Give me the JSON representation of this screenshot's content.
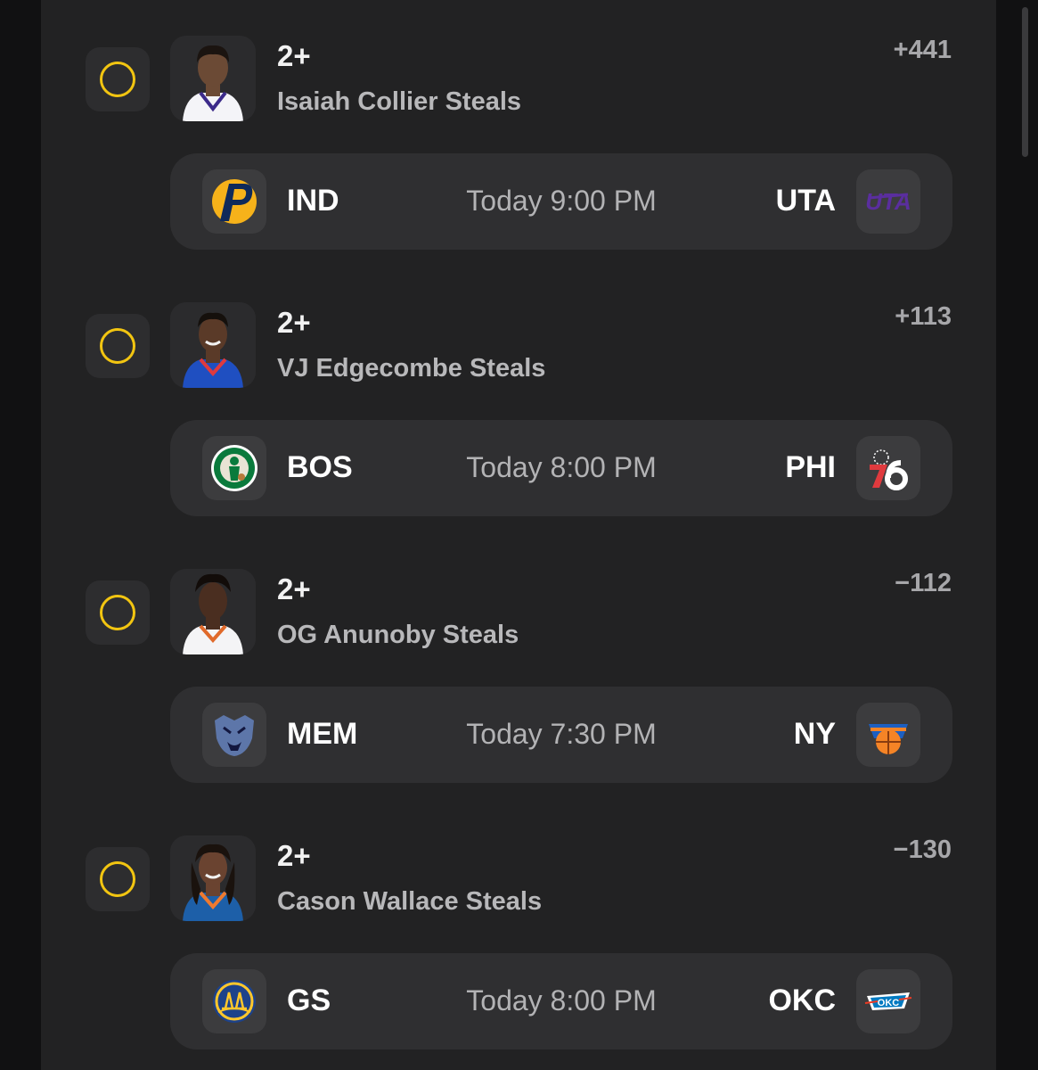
{
  "props": [
    {
      "line": "2+",
      "player": "Isaiah Collier Steals",
      "odds": "+441",
      "away_team": "IND",
      "home_team": "UTA",
      "game_time": "Today 9:00 PM",
      "away_logo": "pacers-logo",
      "home_logo": "jazz-logo",
      "jersey_color": "#f4f4f8",
      "jersey_trim": "#3b2a8a"
    },
    {
      "line": "2+",
      "player": "VJ Edgecombe Steals",
      "odds": "+113",
      "away_team": "BOS",
      "home_team": "PHI",
      "game_time": "Today 8:00 PM",
      "away_logo": "celtics-logo",
      "home_logo": "76ers-logo",
      "jersey_color": "#1f4fc1",
      "jersey_trim": "#e03a3e"
    },
    {
      "line": "2+",
      "player": "OG Anunoby Steals",
      "odds": "−112",
      "away_team": "MEM",
      "home_team": "NY",
      "game_time": "Today 7:30 PM",
      "away_logo": "grizzlies-logo",
      "home_logo": "knicks-logo",
      "jersey_color": "#f4f4f6",
      "jersey_trim": "#e06a2b"
    },
    {
      "line": "2+",
      "player": "Cason Wallace Steals",
      "odds": "−130",
      "away_team": "GS",
      "home_team": "OKC",
      "game_time": "Today 8:00 PM",
      "away_logo": "warriors-logo",
      "home_logo": "thunder-logo",
      "jersey_color": "#1d5fa8",
      "jersey_trim": "#ef7a2f"
    }
  ],
  "colors": {
    "select_ring": "#f2c511",
    "panel_bg": "#222223",
    "card_bg": "#2f2f31"
  }
}
